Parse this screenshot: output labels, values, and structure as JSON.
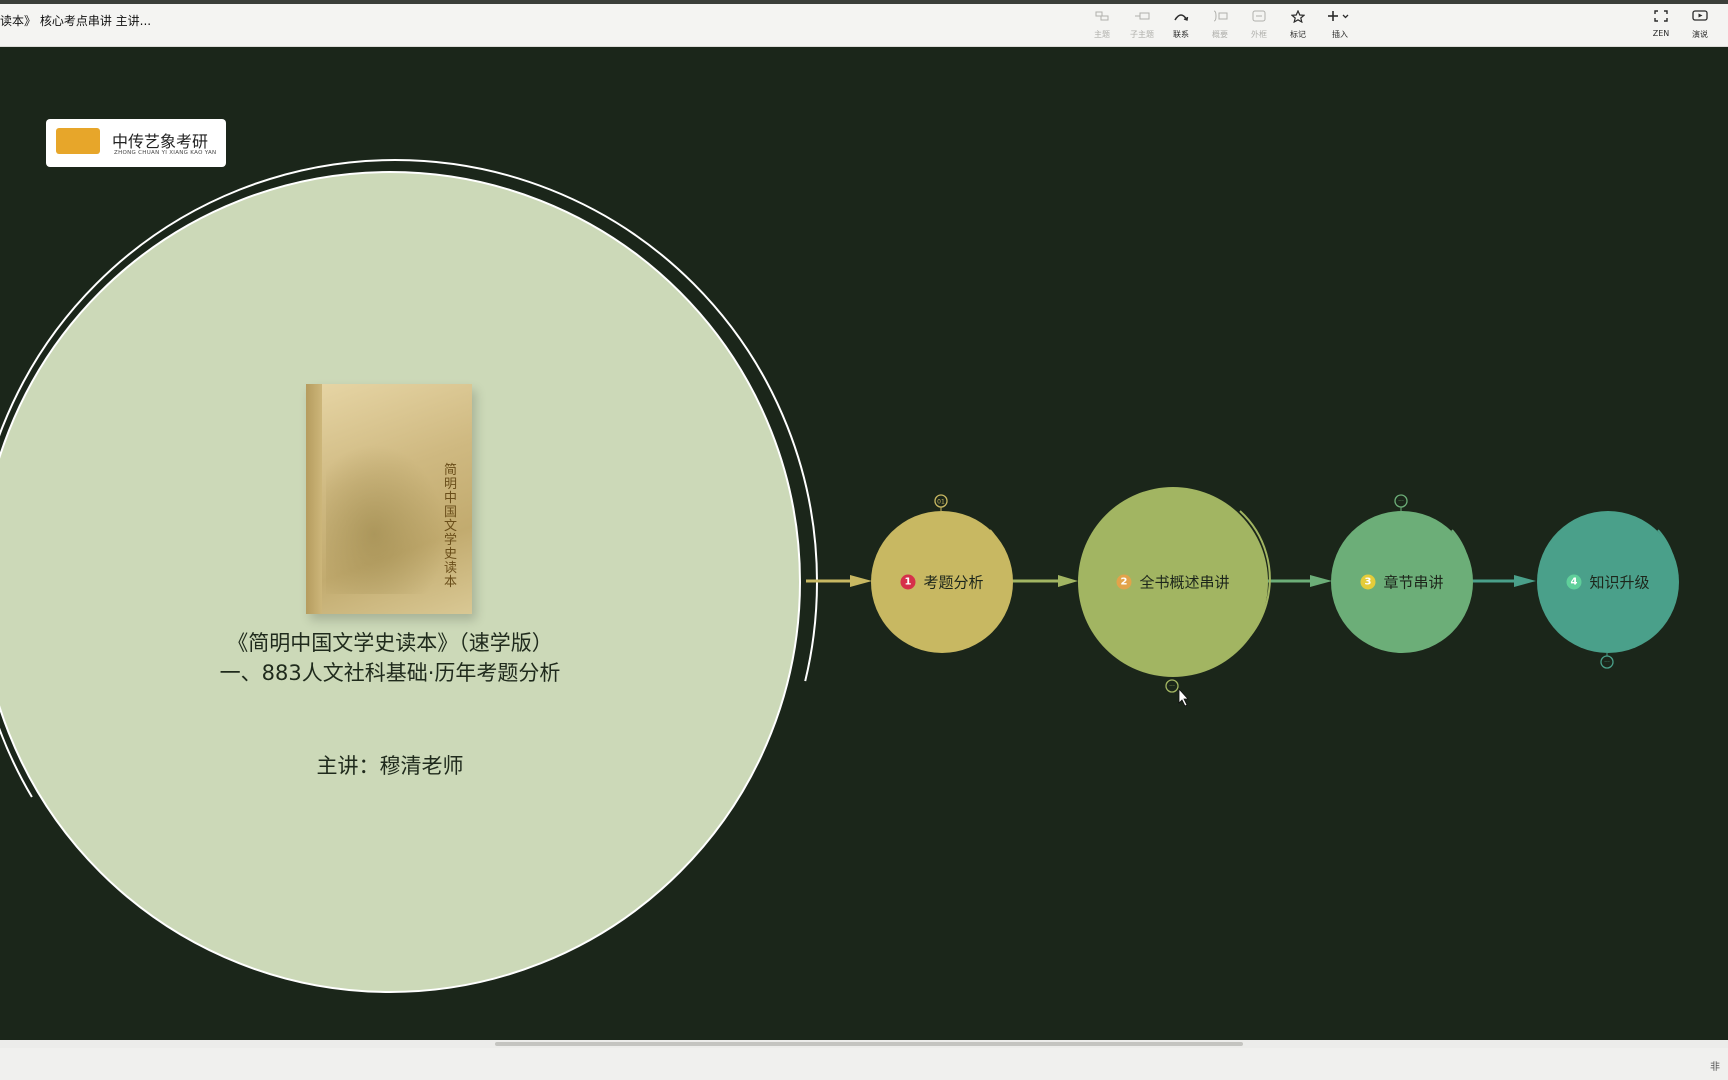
{
  "window": {
    "title": "读本》 核心考点串讲 主讲..."
  },
  "toolbar": {
    "items": [
      {
        "label": "主题",
        "icon": "topic-icon",
        "enabled": false
      },
      {
        "label": "子主题",
        "icon": "subtopic-icon",
        "enabled": false
      },
      {
        "label": "联系",
        "icon": "relationship-icon",
        "enabled": true
      },
      {
        "label": "概要",
        "icon": "summary-icon",
        "enabled": false
      },
      {
        "label": "外框",
        "icon": "boundary-icon",
        "enabled": false
      },
      {
        "label": "标记",
        "icon": "star-icon",
        "enabled": true
      },
      {
        "label": "插入",
        "icon": "plus-icon",
        "enabled": true
      }
    ],
    "right_items": [
      {
        "label": "ZEN",
        "icon": "fullscreen-icon"
      },
      {
        "label": "演说",
        "icon": "present-icon"
      }
    ]
  },
  "logo": {
    "text": "中传艺象考研",
    "subtext": "ZHONG CHUAN YI XIANG KAO YAN"
  },
  "central_topic": {
    "book_title": "简明中国文学史读本",
    "line1": "《简明中国文学史读本》（速学版）",
    "line2": "一、883人文社科基础·历年考题分析",
    "line3": "主讲：穆清老师",
    "color": "#ccd9b8"
  },
  "topics": [
    {
      "num": "1",
      "label": "考题分析",
      "color": "#c8b862",
      "num_color": "#d6304a",
      "badge": "01"
    },
    {
      "num": "2",
      "label": "全书概述串讲",
      "color": "#a2b562",
      "num_color": "#e2a34a"
    },
    {
      "num": "3",
      "label": "章节串讲",
      "color": "#6cae78",
      "num_color": "#e4cc3a"
    },
    {
      "num": "4",
      "label": "知识升级",
      "color": "#4aa08a",
      "num_color": "#5fcf9a"
    }
  ],
  "status": {
    "right_text": "非"
  }
}
